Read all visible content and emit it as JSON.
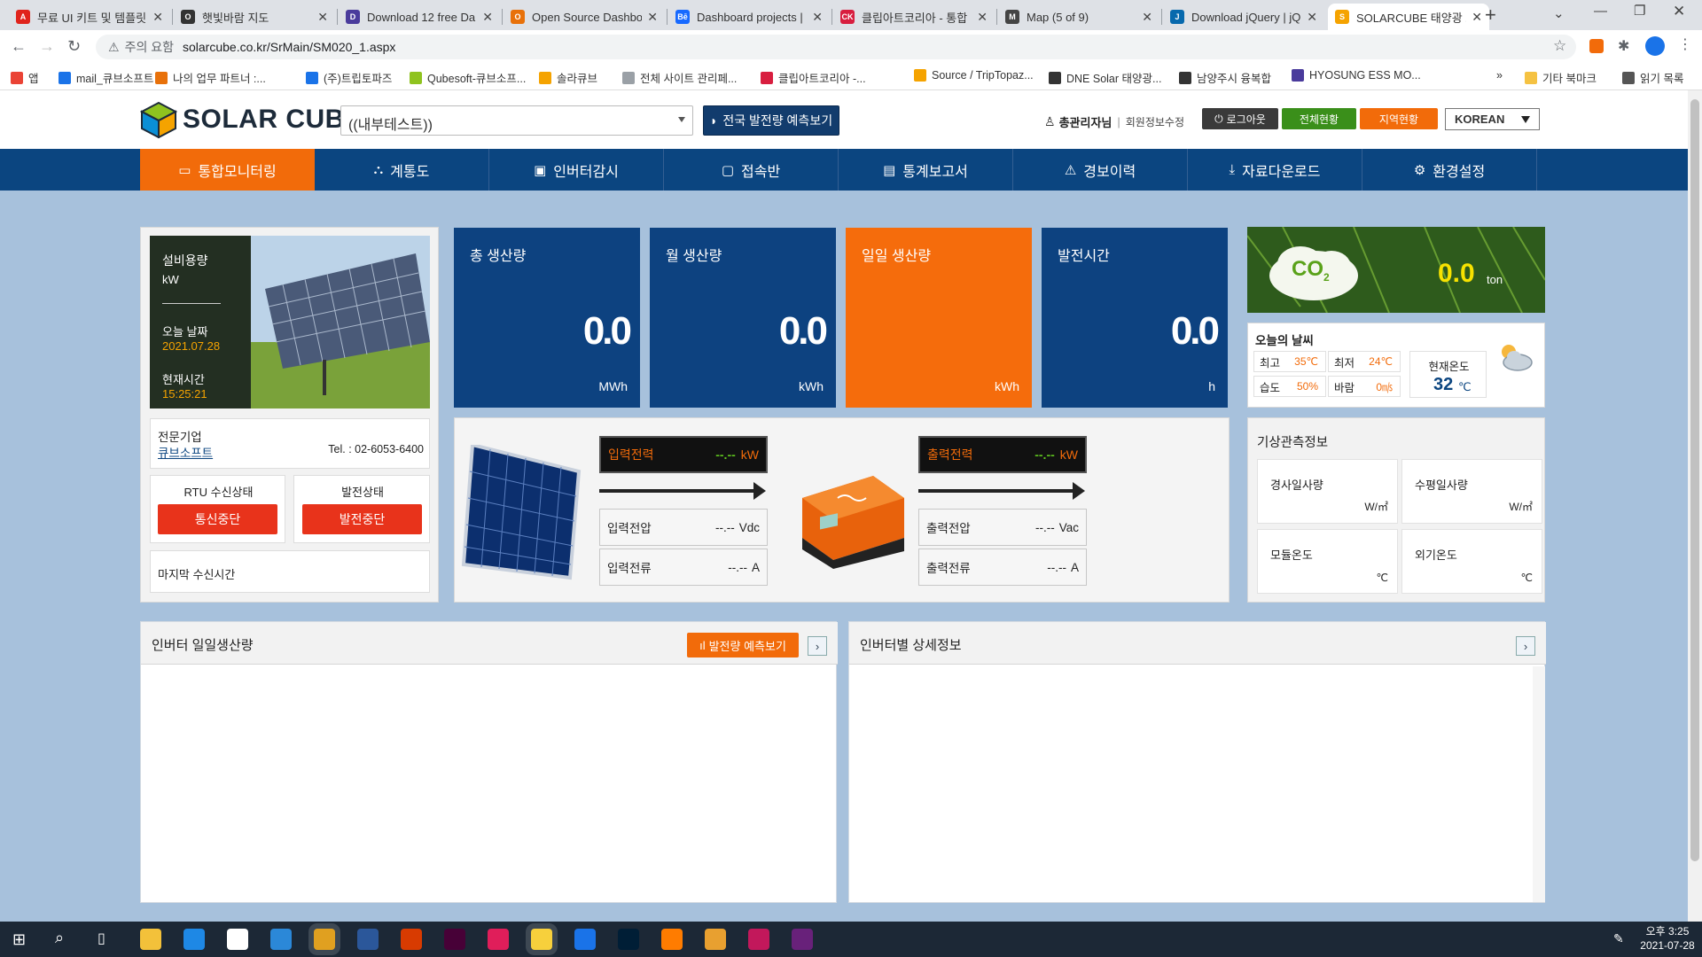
{
  "browser": {
    "tabs": [
      {
        "title": "무료 UI 키트 및 템플릿",
        "color": "#e0241c",
        "glyph": "A"
      },
      {
        "title": "햇빛바람 지도",
        "color": "#333333",
        "glyph": "O"
      },
      {
        "title": "Download 12 free Da",
        "color": "#4a3b9c",
        "glyph": "D"
      },
      {
        "title": "Open Source Dashbo",
        "color": "#e8710a",
        "glyph": "O"
      },
      {
        "title": "Dashboard projects |",
        "color": "#1769ff",
        "glyph": "Bē"
      },
      {
        "title": "클립아트코리아 - 통합",
        "color": "#d81e3f",
        "glyph": "CK"
      },
      {
        "title": "Map (5 of 9)",
        "color": "#444444",
        "glyph": "M"
      },
      {
        "title": "Download jQuery | jQ",
        "color": "#0769ad",
        "glyph": "J"
      },
      {
        "title": "SOLARCUBE 태양광 모",
        "color": "#f5a300",
        "glyph": "S"
      }
    ],
    "warning": "주의 요함",
    "url": "solarcube.co.kr/SrMain/SM020_1.aspx",
    "bookmarks": [
      "앱",
      "mail_큐브소프트",
      "나의 업무 파트너 :...",
      "(주)트립토파즈",
      "Qubesoft-큐브소프...",
      "솔라큐브",
      "전체 사이트 관리페...",
      "클립아트코리아 -...",
      "Source / TripTopaz...",
      "DNE Solar 태양광...",
      "남양주시 융복합",
      "HYOSUNG ESS MO...",
      "기타 북마크",
      "읽기 목록"
    ]
  },
  "header": {
    "logo_text": "SOLAR CUBE",
    "site_select": "((내부테스트))",
    "forecast_button": "전국 발전량 예측보기",
    "user_name": "총관리자님",
    "member_edit": "회원정보수정",
    "logout": "로그아웃",
    "all_status": "전체현황",
    "region_status": "지역현황",
    "language": "KOREAN"
  },
  "nav": [
    {
      "label": "통합모니터링",
      "icon": "monitor-icon",
      "glyph": "▭"
    },
    {
      "label": "계통도",
      "icon": "network-icon",
      "glyph": "⛬"
    },
    {
      "label": "인버터감시",
      "icon": "inverter-icon",
      "glyph": "▣"
    },
    {
      "label": "접속반",
      "icon": "junction-icon",
      "glyph": "▢"
    },
    {
      "label": "통계보고서",
      "icon": "report-icon",
      "glyph": "▤"
    },
    {
      "label": "경보이력",
      "icon": "alarm-icon",
      "glyph": "⚠"
    },
    {
      "label": "자료다운로드",
      "icon": "download-icon",
      "glyph": "⤓"
    },
    {
      "label": "환경설정",
      "icon": "settings-icon",
      "glyph": "⚙"
    }
  ],
  "site_info": {
    "capacity_label": "설비용량",
    "capacity_unit": "kW",
    "today_label": "오늘 날짜",
    "today_value": "2021.07.28",
    "time_label": "현재시간",
    "time_value": "15:25:21",
    "company_label": "전문기업",
    "company_name": "큐브소프트",
    "tel": "Tel. : 02-6053-6400",
    "rtu_label": "RTU 수신상태",
    "rtu_status": "통신중단",
    "gen_label": "발전상태",
    "gen_status": "발전중단",
    "last_recv_label": "마지막 수신시간"
  },
  "kpis": [
    {
      "label": "총 생산량",
      "value": "0.0",
      "unit": "MWh"
    },
    {
      "label": "월 생산량",
      "value": "0.0",
      "unit": "kWh"
    },
    {
      "label": "일일 생산량",
      "value": "",
      "unit": "kWh"
    },
    {
      "label": "발전시간",
      "value": "0.0",
      "unit": "h"
    }
  ],
  "power": {
    "input_power_label": "입력전력",
    "input_power_value": "--.--",
    "input_power_unit": "kW",
    "input_voltage_label": "입력전압",
    "input_voltage_value": "--.--",
    "input_voltage_unit": "Vdc",
    "input_current_label": "입력전류",
    "input_current_value": "--.--",
    "input_current_unit": "A",
    "output_power_label": "출력전력",
    "output_power_value": "--.--",
    "output_power_unit": "kW",
    "output_voltage_label": "출력전압",
    "output_voltage_value": "--.--",
    "output_voltage_unit": "Vac",
    "output_current_label": "출력전류",
    "output_current_value": "--.--",
    "output_current_unit": "A"
  },
  "co2": {
    "label": "CO",
    "sub": "2",
    "value": "0.0",
    "unit": "ton"
  },
  "weather": {
    "title": "오늘의 날씨",
    "high_label": "최고",
    "high_value": "35℃",
    "low_label": "최저",
    "low_value": "24℃",
    "humidity_label": "습도",
    "humidity_value": "50%",
    "wind_label": "바람",
    "wind_value": "0㎧",
    "current_label": "현재온도",
    "current_value": "32",
    "current_unit": "℃"
  },
  "observation": {
    "title": "기상관측정보",
    "items": [
      {
        "label": "경사일사량",
        "unit": "W/㎡"
      },
      {
        "label": "수평일사량",
        "unit": "W/㎡"
      },
      {
        "label": "모듈온도",
        "unit": "℃"
      },
      {
        "label": "외기온도",
        "unit": "℃"
      }
    ]
  },
  "bottom": {
    "daily_title": "인버터 일일생산량",
    "daily_forecast_btn": "발전량 예측보기",
    "detail_title": "인버터별 상세정보"
  },
  "taskbar": {
    "time": "오후 3:25",
    "date": "2021-07-28"
  }
}
